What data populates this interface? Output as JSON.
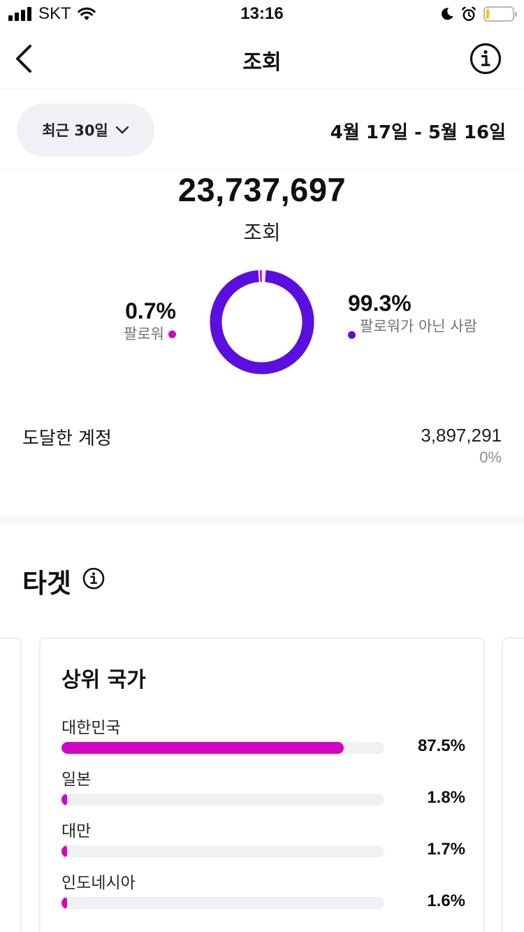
{
  "status_bar": {
    "carrier": "SKT",
    "time": "13:16",
    "icons": [
      "signal-icon",
      "wifi-icon",
      "moon-icon",
      "alarm-icon",
      "battery-icon"
    ],
    "battery_fill": 0.12,
    "battery_color": "#f5c800"
  },
  "nav": {
    "title": "조회",
    "back_icon": "chevron-left-icon",
    "info_icon": "info-icon"
  },
  "period": {
    "selected": "최근 30일",
    "date_range": "4월 17일 - 5월 16일"
  },
  "summary": {
    "total": "23,737,697",
    "total_label": "조회",
    "followers": {
      "percent": "0.7%",
      "label": "팔로워",
      "value": 0.7,
      "color": "#d305c3"
    },
    "non_followers": {
      "percent": "99.3%",
      "label": "팔로워가 아닌 사람",
      "value": 99.3,
      "color": "#5b0ee0"
    }
  },
  "reach": {
    "label": "도달한 계정",
    "value": "3,897,291",
    "change": "0%"
  },
  "target": {
    "title": "타겟",
    "card_title": "상위 국가",
    "countries": [
      {
        "name": "대한민국",
        "percent": "87.5%",
        "value": 87.5
      },
      {
        "name": "일본",
        "percent": "1.8%",
        "value": 1.8
      },
      {
        "name": "대만",
        "percent": "1.7%",
        "value": 1.7
      },
      {
        "name": "인도네시아",
        "percent": "1.6%",
        "value": 1.6
      }
    ],
    "bar_color": "#d305c3"
  }
}
